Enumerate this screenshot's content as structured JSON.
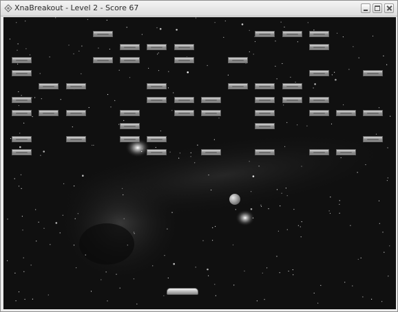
{
  "window": {
    "title": "XnaBreakout - Level 2 - Score 67",
    "icon": "xna-app-icon"
  },
  "controls": {
    "minimize": "minimize-icon",
    "maximize": "maximize-icon",
    "close": "close-icon"
  },
  "game": {
    "level": 2,
    "score": 67,
    "colors": {
      "background": "#101010",
      "brick": "#a8a8a8"
    },
    "bricks": [
      [
        0,
        0,
        0,
        1,
        0,
        0,
        0,
        0,
        0,
        1,
        1,
        1,
        0,
        0
      ],
      [
        0,
        0,
        0,
        0,
        1,
        1,
        1,
        0,
        0,
        0,
        0,
        1,
        0,
        0
      ],
      [
        1,
        0,
        0,
        1,
        1,
        0,
        1,
        0,
        1,
        0,
        0,
        0,
        0,
        0
      ],
      [
        1,
        0,
        0,
        0,
        0,
        0,
        0,
        0,
        0,
        0,
        0,
        1,
        0,
        1
      ],
      [
        0,
        1,
        1,
        0,
        0,
        1,
        0,
        0,
        1,
        1,
        1,
        0,
        0,
        0
      ],
      [
        1,
        0,
        0,
        0,
        0,
        1,
        1,
        1,
        0,
        1,
        1,
        1,
        0,
        0
      ],
      [
        1,
        1,
        1,
        0,
        1,
        0,
        1,
        1,
        0,
        1,
        0,
        1,
        1,
        1
      ],
      [
        0,
        0,
        0,
        0,
        1,
        0,
        0,
        0,
        0,
        1,
        0,
        0,
        0,
        0
      ],
      [
        1,
        0,
        1,
        0,
        1,
        1,
        0,
        0,
        0,
        0,
        0,
        0,
        0,
        1
      ],
      [
        1,
        0,
        0,
        0,
        0,
        1,
        0,
        1,
        0,
        1,
        0,
        1,
        1,
        0
      ]
    ]
  }
}
